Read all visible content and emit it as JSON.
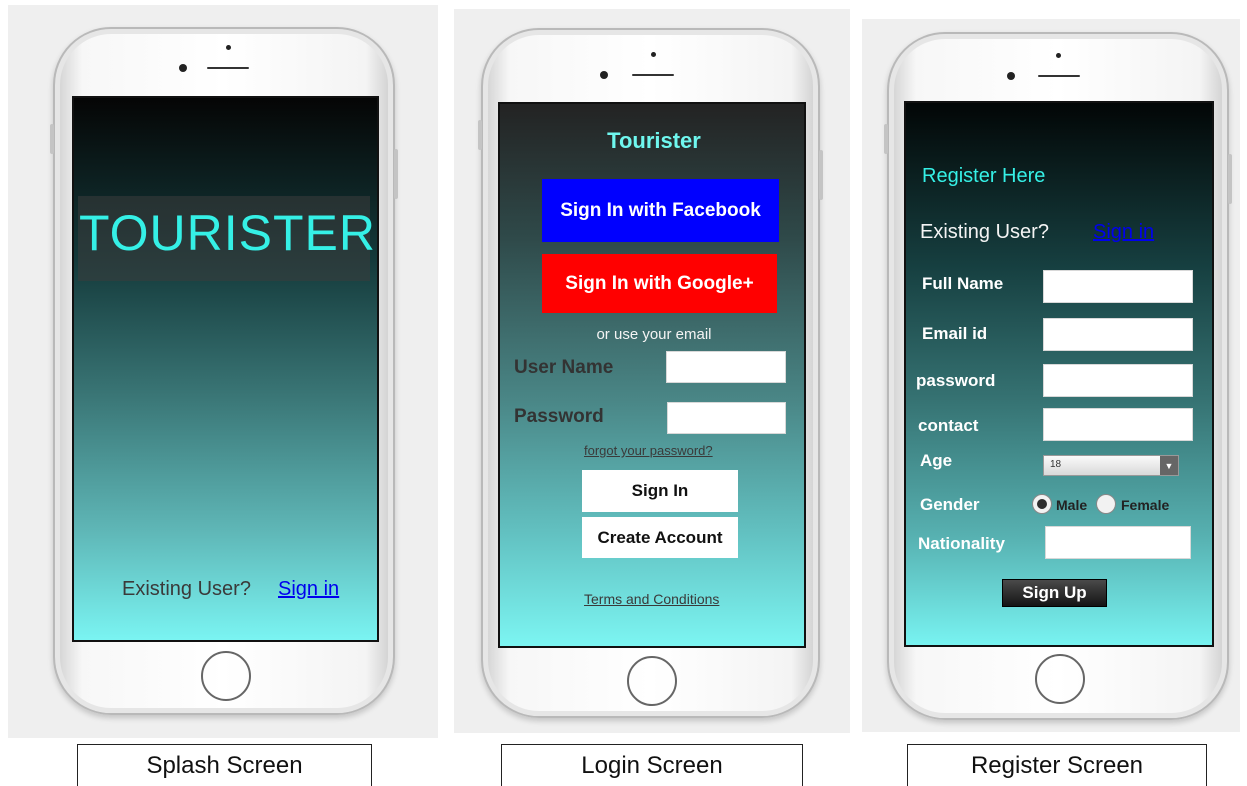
{
  "splash": {
    "title": "TOURISTER",
    "existing_user": "Existing User?",
    "sign_in": "Sign in",
    "caption": "Splash Screen"
  },
  "login": {
    "title": "Tourister",
    "facebook": "Sign In with Facebook",
    "google": "Sign In with Google+",
    "or_email": "or use your email",
    "username_label": "User Name",
    "password_label": "Password",
    "forgot": "forgot your password?",
    "sign_in": "Sign In",
    "create_account": "Create Account",
    "terms": "Terms and Conditions",
    "caption": "Login Screen"
  },
  "register": {
    "title": "Register Here",
    "existing_user": "Existing User?",
    "sign_in": "Sign in",
    "full_name": "Full Name",
    "email": "Email id",
    "password": "password",
    "contact": "contact",
    "age": "Age",
    "age_value": "18",
    "gender": "Gender",
    "male": "Male",
    "female": "Female",
    "nationality": "Nationality",
    "sign_up": "Sign Up",
    "caption": "Register Screen"
  },
  "colors": {
    "accent_cyan": "#35f0e6",
    "facebook_blue": "#0000ff",
    "google_red": "#ff0000",
    "link_blue": "#0000ee"
  }
}
